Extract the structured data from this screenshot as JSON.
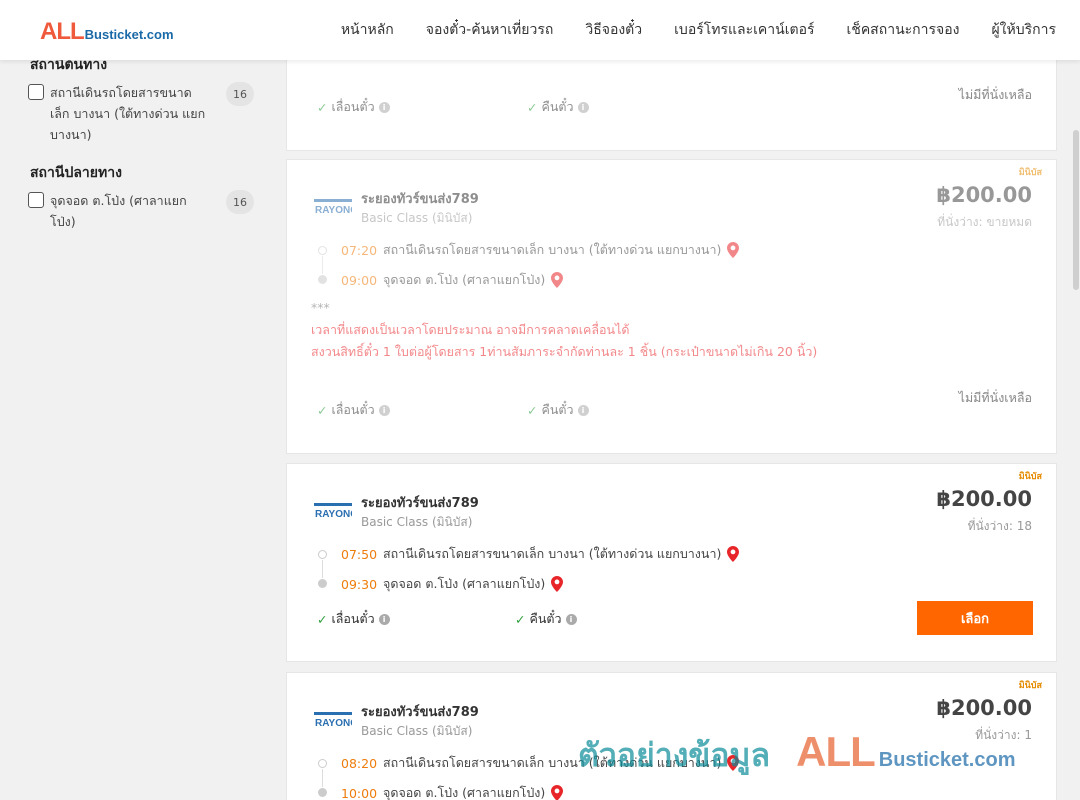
{
  "header": {
    "logo_all": "ALL",
    "logo_rest": "Busticket.com",
    "nav": [
      "หน้าหลัก",
      "จองตั๋ว-ค้นหาเที่ยวรถ",
      "วิธีจองตั๋ว",
      "เบอร์โทรและเคาน์เตอร์",
      "เช็คสถานะการจอง",
      "ผู้ให้บริการ"
    ]
  },
  "sidebar": {
    "origin_title": "สถานีต้นทาง",
    "origin_option": "สถานีเดินรถโดยสารขนาดเล็ก บางนา (ใต้ทางด่วน แยกบางนา)",
    "origin_count": "16",
    "dest_title": "สถานีปลายทาง",
    "dest_option": "จุดจอด ต.โป่ง (ศาลาแยกโป่ง)",
    "dest_count": "16"
  },
  "labels": {
    "change": "เลื่อนตั๋ว",
    "refund": "คืนตั๋ว",
    "no_seat": "ไม่มีที่นั่งเหลือ",
    "select": "เลือก",
    "badge": "มินิบัส",
    "logo_text": "RAYONG"
  },
  "trips": [
    {
      "operator": "ระยองทัวร์ขนส่ง789",
      "class": "Basic Class (มินิบัส)",
      "price": "฿200.00",
      "seats": "ที่นั่งว่าง: ขายหมด",
      "depart_time": "07:20",
      "depart_place": "สถานีเดินรถโดยสารขนาดเล็ก บางนา (ใต้ทางด่วน แยกบางนา)",
      "arrive_time": "09:00",
      "arrive_place": "จุดจอด ต.โป่ง (ศาลาแยกโป่ง)",
      "notes": {
        "stars": "***",
        "line1": "เวลาที่แสดงเป็นเวลาโดยประมาณ อาจมีการคลาดเคลื่อนได้",
        "line2": "สงวนสิทธิ์ตั๋ว 1 ใบต่อผู้โดยสาร 1ท่านสัมภาระจำกัดท่านละ 1 ชิ้น (กระเป๋าขนาดไม่เกิน 20 นิ้ว)"
      }
    },
    {
      "operator": "ระยองทัวร์ขนส่ง789",
      "class": "Basic Class (มินิบัส)",
      "price": "฿200.00",
      "seats": "ที่นั่งว่าง: 18",
      "depart_time": "07:50",
      "depart_place": "สถานีเดินรถโดยสารขนาดเล็ก บางนา (ใต้ทางด่วน แยกบางนา)",
      "arrive_time": "09:30",
      "arrive_place": "จุดจอด ต.โป่ง (ศาลาแยกโป่ง)"
    },
    {
      "operator": "ระยองทัวร์ขนส่ง789",
      "class": "Basic Class (มินิบัส)",
      "price": "฿200.00",
      "seats": "ที่นั่งว่าง: 1",
      "depart_time": "08:20",
      "depart_place": "สถานีเดินรถโดยสารขนาดเล็ก บางนา (ใต้ทางด่วน แยกบางนา)",
      "arrive_time": "10:00",
      "arrive_place": "จุดจอด ต.โป่ง (ศาลาแยกโป่ง)"
    }
  ],
  "watermark": {
    "text": "ตัวอย่างข้อมูล",
    "all": "ALL",
    "rest": "Busticket.com"
  },
  "colors": {
    "accent": "#ff6600",
    "time": "#ee7d0d",
    "warning": "#e8262a",
    "check": "#2e9e3e"
  }
}
